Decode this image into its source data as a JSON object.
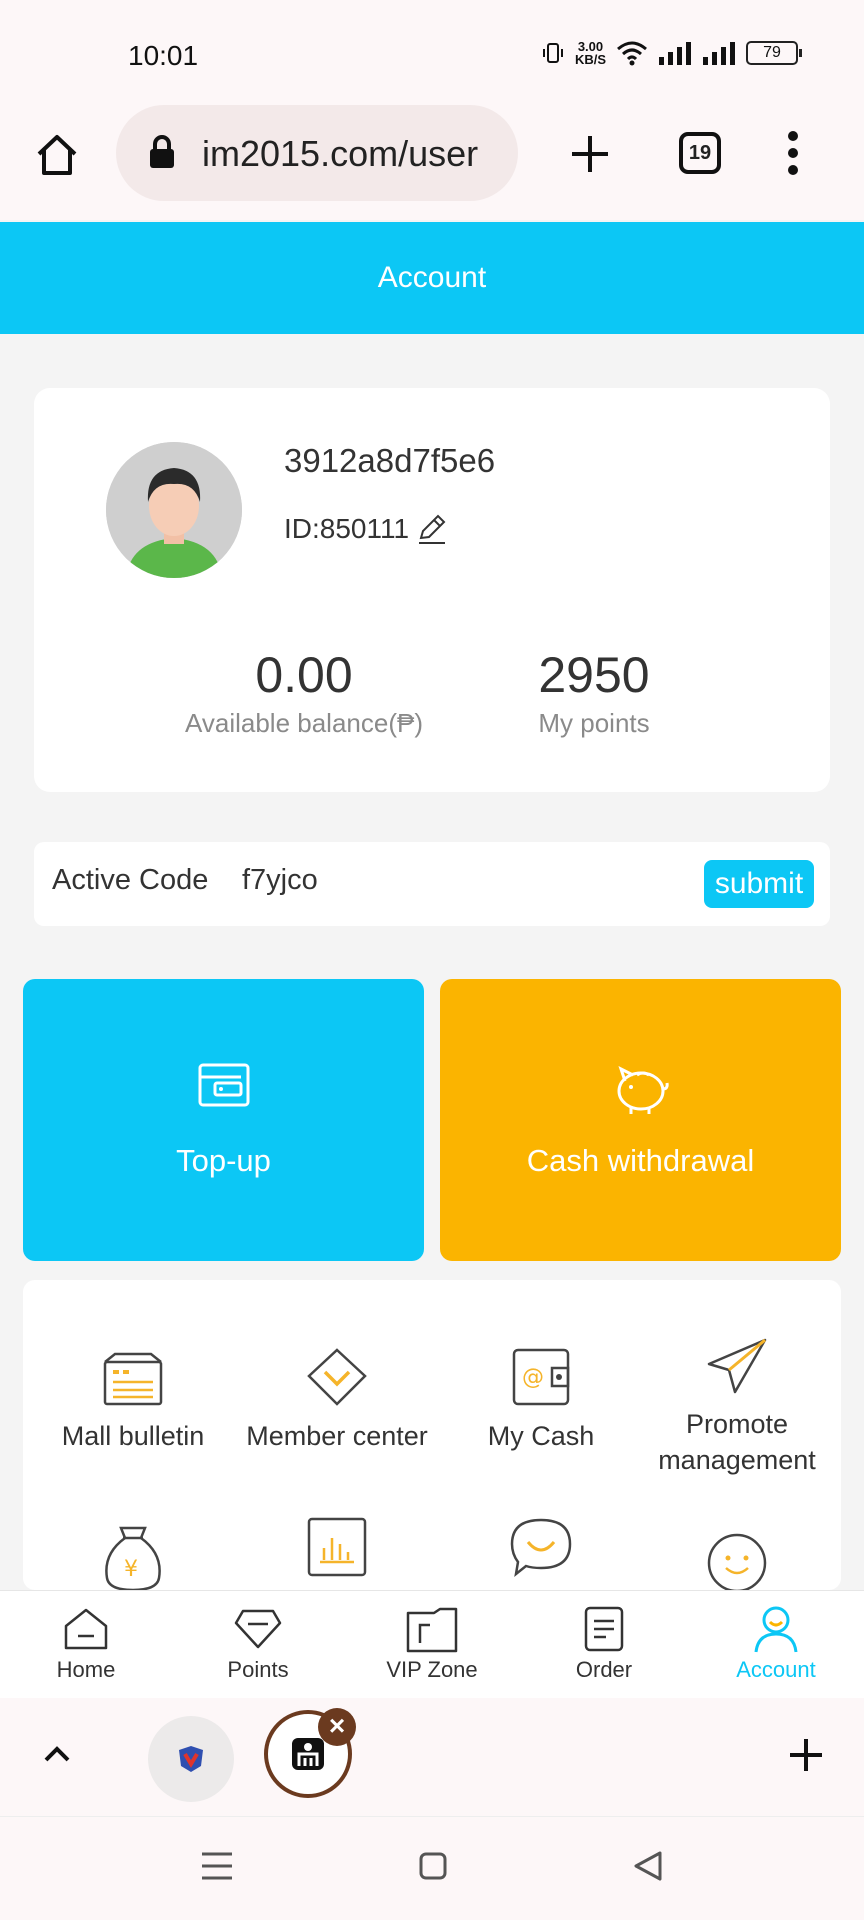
{
  "status_bar": {
    "time": "10:01",
    "net_speed_value": "3.00",
    "net_speed_unit": "KB/S",
    "battery": "79"
  },
  "browser": {
    "url": "im2015.com/user",
    "tab_count": "19"
  },
  "header": {
    "title": "Account"
  },
  "profile": {
    "username": "3912a8d7f5e6",
    "id_label": "ID:850111",
    "balance_value": "0.00",
    "balance_label": "Available balance(₱)",
    "points_value": "2950",
    "points_label": "My points"
  },
  "active_code": {
    "label": "Active Code",
    "value": "f7yjco",
    "button": "submit"
  },
  "actions": {
    "topup": "Top-up",
    "withdraw": "Cash withdrawal"
  },
  "grid_items": [
    {
      "label": "Mall bulletin",
      "icon": "bulletin-icon"
    },
    {
      "label": "Member center",
      "icon": "diamond-icon"
    },
    {
      "label": "My Cash",
      "icon": "wallet-icon"
    },
    {
      "label": "Promote management",
      "label_line1": "Promote",
      "label_line2": "management",
      "icon": "paper-plane-icon"
    },
    {
      "icon": "money-bag-icon"
    },
    {
      "icon": "bar-chart-icon"
    },
    {
      "icon": "chat-bubble-icon"
    },
    {
      "icon": "smiley-icon"
    }
  ],
  "tabbar": [
    {
      "label": "Home",
      "icon": "home-icon"
    },
    {
      "label": "Points",
      "icon": "diamond-icon"
    },
    {
      "label": "VIP Zone",
      "icon": "vip-icon"
    },
    {
      "label": "Order",
      "icon": "order-icon"
    },
    {
      "label": "Account",
      "icon": "account-icon",
      "active": true
    }
  ],
  "colors": {
    "accent": "#0cc7f5",
    "orange": "#fbb400",
    "icon_orange": "#f5b42a"
  }
}
